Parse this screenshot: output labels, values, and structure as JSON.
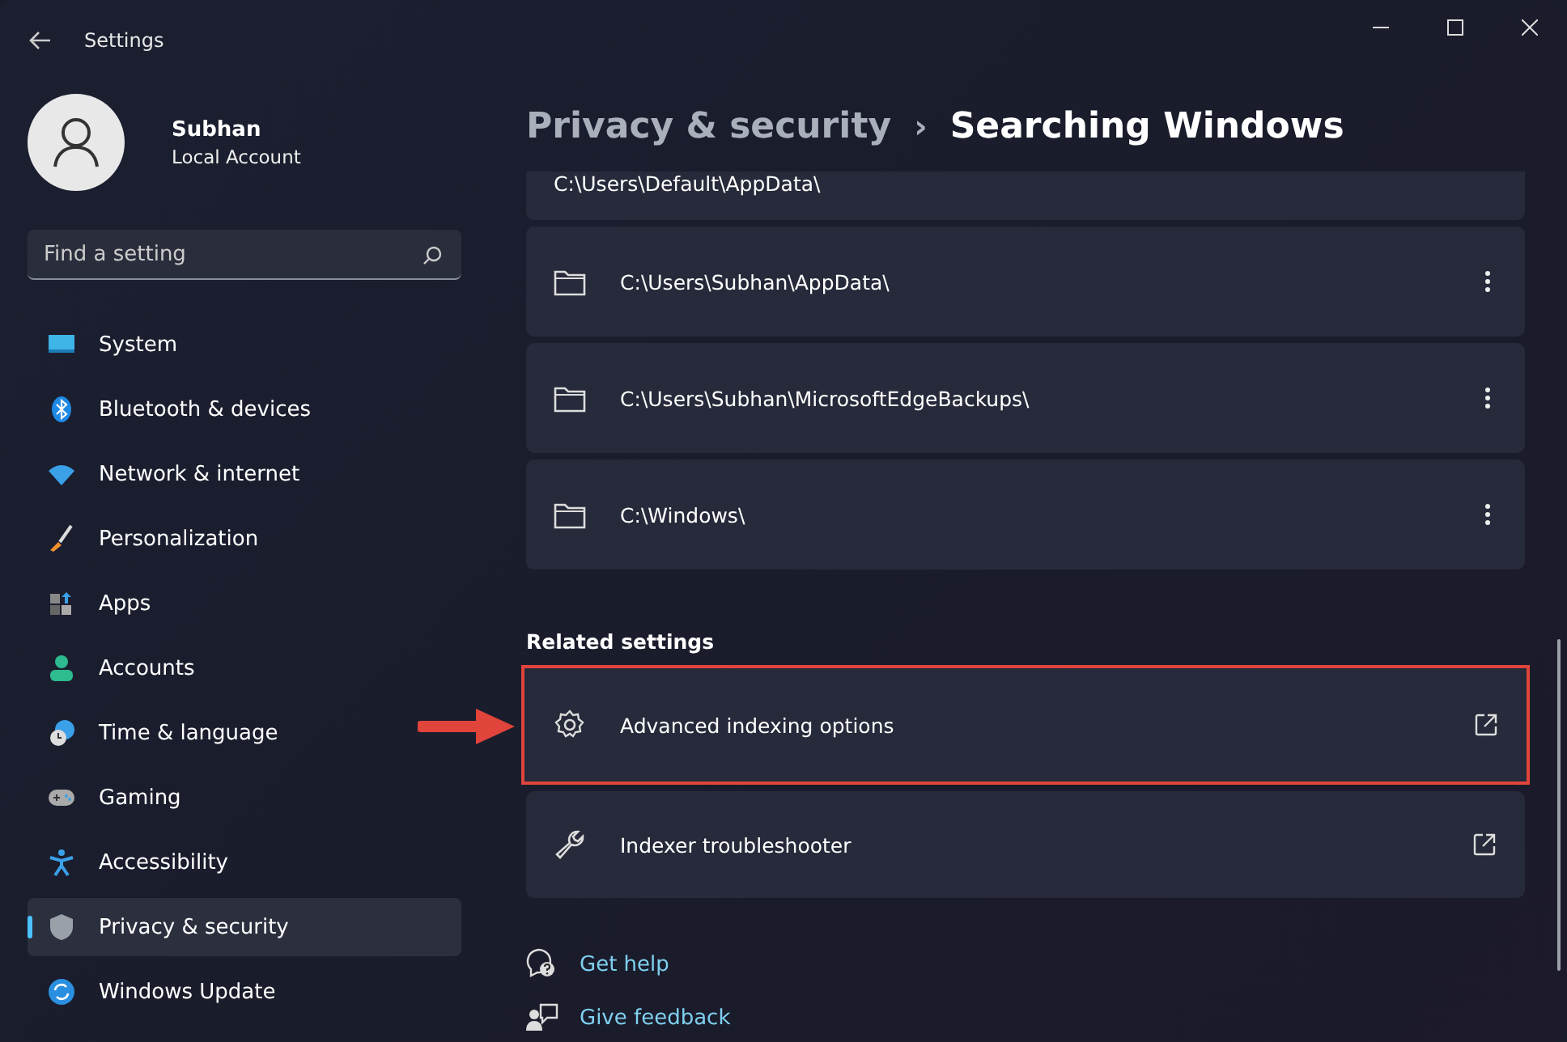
{
  "window": {
    "title": "Settings"
  },
  "user": {
    "name": "Subhan",
    "account": "Local Account"
  },
  "search": {
    "placeholder": "Find a setting"
  },
  "sidebar": {
    "items": [
      {
        "label": "System",
        "selected": false
      },
      {
        "label": "Bluetooth & devices",
        "selected": false
      },
      {
        "label": "Network & internet",
        "selected": false
      },
      {
        "label": "Personalization",
        "selected": false
      },
      {
        "label": "Apps",
        "selected": false
      },
      {
        "label": "Accounts",
        "selected": false
      },
      {
        "label": "Time & language",
        "selected": false
      },
      {
        "label": "Gaming",
        "selected": false
      },
      {
        "label": "Accessibility",
        "selected": false
      },
      {
        "label": "Privacy & security",
        "selected": true
      },
      {
        "label": "Windows Update",
        "selected": false
      }
    ]
  },
  "breadcrumb": {
    "parent": "Privacy & security",
    "separator": "›",
    "current": "Searching Windows"
  },
  "folders": [
    {
      "path": "C:\\Users\\Default\\AppData\\",
      "partial": true
    },
    {
      "path": "C:\\Users\\Subhan\\AppData\\",
      "partial": false
    },
    {
      "path": "C:\\Users\\Subhan\\MicrosoftEdgeBackups\\",
      "partial": false
    },
    {
      "path": "C:\\Windows\\",
      "partial": false
    }
  ],
  "related": {
    "heading": "Related settings",
    "items": [
      {
        "label": "Advanced indexing options",
        "highlighted": true
      },
      {
        "label": "Indexer troubleshooter",
        "highlighted": false
      }
    ]
  },
  "links": [
    {
      "label": "Get help"
    },
    {
      "label": "Give feedback"
    }
  ]
}
